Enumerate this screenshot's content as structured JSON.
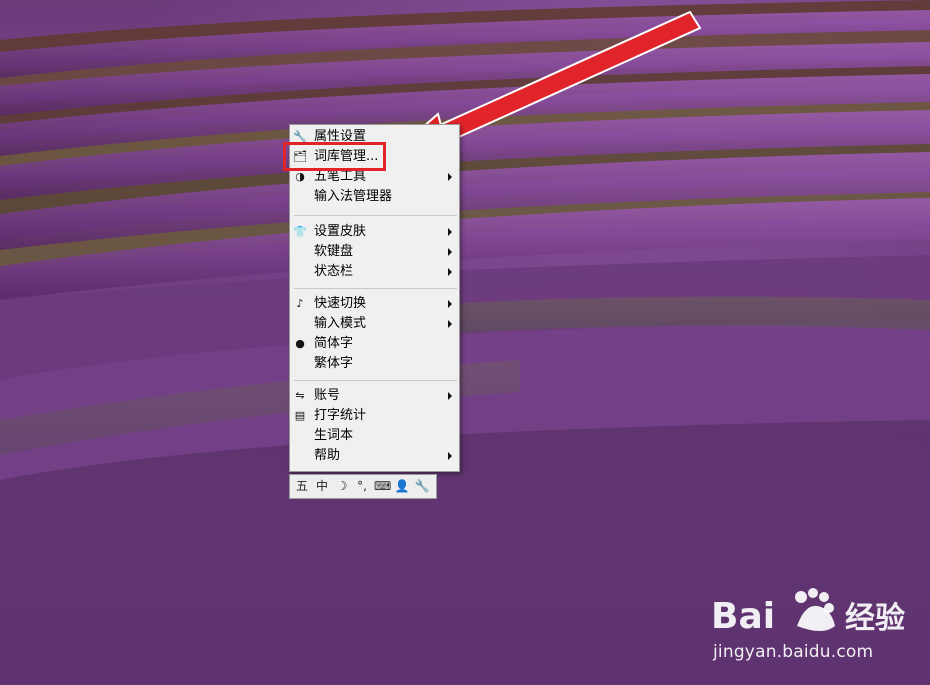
{
  "menu": {
    "items": [
      {
        "label": "属性设置",
        "icon": "wrench-icon",
        "submenu": false
      },
      {
        "label": "词库管理...",
        "icon": "dictionary-icon",
        "submenu": false
      },
      {
        "label": "五笔工具",
        "icon": "tools-icon",
        "submenu": true
      },
      {
        "label": "输入法管理器",
        "icon": "",
        "submenu": false
      },
      {
        "label": "设置皮肤",
        "icon": "shirt-icon",
        "submenu": true
      },
      {
        "label": "软键盘",
        "icon": "",
        "submenu": true
      },
      {
        "label": "状态栏",
        "icon": "",
        "submenu": true
      },
      {
        "label": "快速切换",
        "icon": "switch-icon",
        "submenu": true
      },
      {
        "label": "输入模式",
        "icon": "",
        "submenu": true
      },
      {
        "label": "简体字",
        "icon": "dot-icon",
        "submenu": false
      },
      {
        "label": "繁体字",
        "icon": "",
        "submenu": false
      },
      {
        "label": "账号",
        "icon": "account-icon",
        "submenu": true
      },
      {
        "label": "打字统计",
        "icon": "stats-icon",
        "submenu": false
      },
      {
        "label": "生词本",
        "icon": "",
        "submenu": false
      },
      {
        "label": "帮助",
        "icon": "",
        "submenu": true
      }
    ]
  },
  "toolbar": {
    "items": [
      {
        "name": "ime-logo-icon",
        "glyph": "五"
      },
      {
        "name": "chinese-mode-icon",
        "glyph": "中"
      },
      {
        "name": "moon-icon",
        "glyph": "☽"
      },
      {
        "name": "punctuation-icon",
        "glyph": "°,"
      },
      {
        "name": "keyboard-icon",
        "glyph": "⌨"
      },
      {
        "name": "user-icon",
        "glyph": "👤"
      },
      {
        "name": "wrench-icon",
        "glyph": "🔧"
      }
    ]
  },
  "watermark": {
    "logo_text": "Bai",
    "logo_text2": "经验",
    "url": "jingyan.baidu.com"
  },
  "colors": {
    "highlight": "#e0242a",
    "arrow": "#e0242a",
    "menu_bg": "#f0f0f0"
  }
}
